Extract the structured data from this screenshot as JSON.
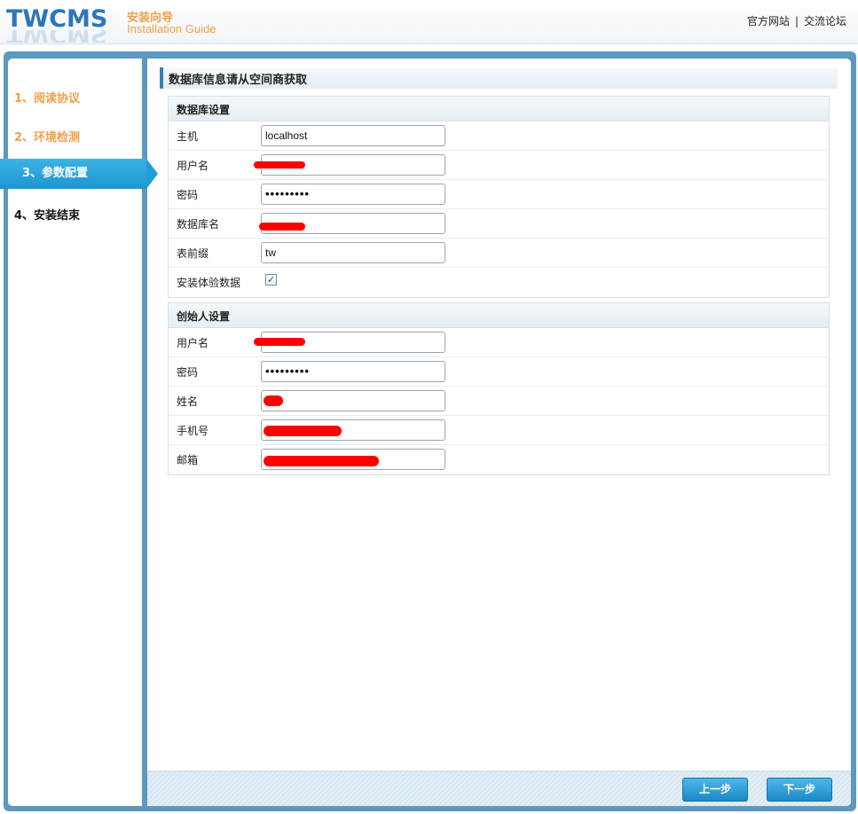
{
  "header": {
    "logo": "TWCMS",
    "title_cn": "安装向导",
    "title_en": "Installation Guide",
    "links": [
      "官方网站",
      "交流论坛"
    ],
    "separator": "|"
  },
  "steps": [
    {
      "label": "1、阅读协议",
      "state": "done"
    },
    {
      "label": "2、环境检测",
      "state": "done"
    },
    {
      "label": "3、参数配置",
      "state": "active"
    },
    {
      "label": "4、安装结束",
      "state": "todo"
    }
  ],
  "content": {
    "section_title": "数据库信息请从空间商获取",
    "db_group": {
      "title": "数据库设置",
      "host_label": "主机",
      "host_value": "localhost",
      "user_label": "用户名",
      "user_value": "",
      "password_label": "密码",
      "password_value": "•••••••••",
      "dbname_label": "数据库名",
      "dbname_value": "",
      "prefix_label": "表前缀",
      "prefix_value": "tw",
      "demo_label": "安装体验数据",
      "demo_checked": true
    },
    "founder_group": {
      "title": "创始人设置",
      "user_label": "用户名",
      "user_value": "",
      "password_label": "密码",
      "password_value": "•••••••••",
      "name_label": "姓名",
      "name_value": "",
      "phone_label": "手机号",
      "phone_value": "",
      "email_label": "邮箱",
      "email_value": ""
    }
  },
  "footer": {
    "prev_label": "上一步",
    "next_label": "下一步"
  },
  "colors": {
    "accent": "#249dd6",
    "frame": "#5c98bf",
    "done_step": "#f0a04b",
    "redaction": "#ff0000"
  }
}
